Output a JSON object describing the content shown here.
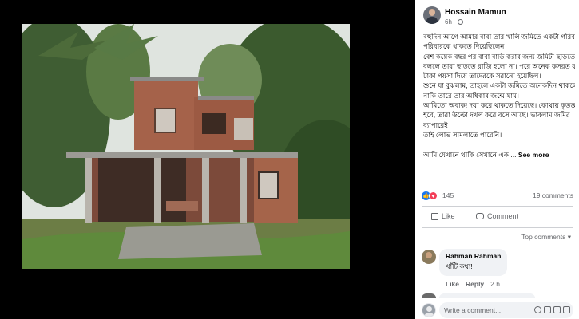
{
  "post": {
    "author": "Hossain Mamun",
    "time": "6h",
    "privacy_icon": "globe-icon",
    "text_lines": [
      "বহুদিন আগে আমার বাবা তার খালি জমিতে একটা গরিব",
      "পরিবারকে থাকতে দিয়েছিলেন।",
      "বেশ কয়েক বছর পর বাবা বাড়ি করার জন্য জমিটা ছাড়তে",
      "বললে তারা ছাড়তে রাজি হলো না। পরে অনেক কসরত করে,",
      "টাকা পয়সা দিয়ে তাদেরকে সরানো হয়েছিল।",
      "শুনে যা বুঝলাম, তাহলে একটা জমিতে অনেকদিন থাকলে",
      "নাকি তারে তার অধিকার জন্মে যায়।",
      "আমিতো অবাক! দয়া করে থাকতে দিয়েছে। কোথায় কৃতজ্ঞ",
      "হবে, তারা উল্টো দখল করে বসে আছে। ভাবলাম জমির",
      "ব্যাপারেই",
      "তাই লোভ সামলাতে পারেনি।",
      "",
      "আমি যেখানে থাকি সেখানে এক ..."
    ],
    "see_more": "See more"
  },
  "reactions": {
    "count": "145",
    "comments": "19 comments",
    "like_color": "#1877f2",
    "love_color": "#f33e58"
  },
  "actions": {
    "like": "Like",
    "comment": "Comment"
  },
  "comments": {
    "sort_label": "Top comments ▾",
    "items": [
      {
        "name": "Rahman Rahman",
        "text": "খাঁটি কথা!",
        "like": "Like",
        "reply": "Reply",
        "time": "2 h"
      }
    ],
    "write_placeholder": "Write a comment..."
  }
}
